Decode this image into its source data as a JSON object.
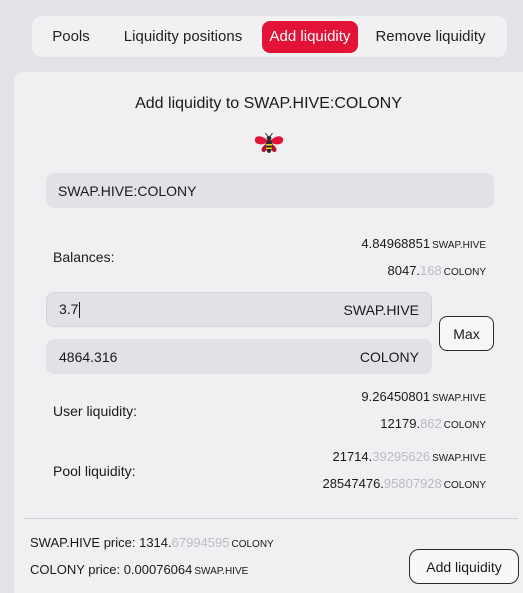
{
  "tabs": {
    "pools": "Pools",
    "positions": "Liquidity positions",
    "add": "Add liquidity",
    "remove": "Remove liquidity",
    "active": "add"
  },
  "card": {
    "title": "Add liquidity to SWAP.HIVE:COLONY",
    "logo_icon": "bee-icon",
    "pair": "SWAP.HIVE:COLONY"
  },
  "balances": {
    "label": "Balances:",
    "a_main": "4.84968851",
    "a_dim": "",
    "a_sym": "SWAP.HIVE",
    "b_main": "8047.",
    "b_dim": "168",
    "b_sym": "COLONY"
  },
  "inputs": {
    "a_value": "3.7",
    "a_sym": "SWAP.HIVE",
    "b_value": "4864.316",
    "b_sym": "COLONY",
    "max_label": "Max"
  },
  "user_liquidity": {
    "label": "User liquidity:",
    "a_main": "9.26450801",
    "a_dim": "",
    "a_sym": "SWAP.HIVE",
    "b_main": "12179.",
    "b_dim": "862",
    "b_sym": "COLONY"
  },
  "pool_liquidity": {
    "label": "Pool liquidity:",
    "a_main": "21714.",
    "a_dim": "39295626",
    "a_sym": "SWAP.HIVE",
    "b_main": "28547476.",
    "b_dim": "95807928",
    "b_sym": "COLONY"
  },
  "prices": {
    "a_label": "SWAP.HIVE price: ",
    "a_main": "1314.",
    "a_dim": "67994595",
    "a_sym": "COLONY",
    "b_label": "COLONY price: ",
    "b_main": "0.00076064",
    "b_sym": "SWAP.HIVE"
  },
  "add_button": "Add liquidity",
  "colors": {
    "accent": "#e31337",
    "background": "#e2e3e6",
    "card": "#f0f0f2",
    "field": "#e1e2e5",
    "muted": "#b9bcc2"
  }
}
